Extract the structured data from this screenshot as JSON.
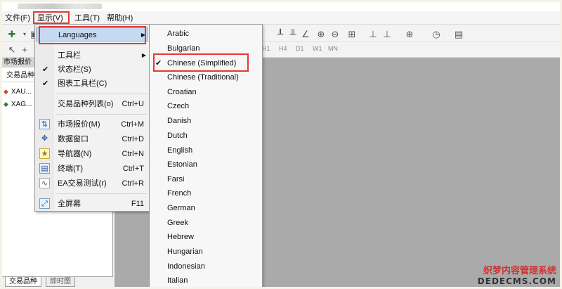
{
  "menubar": {
    "file": "文件(F)",
    "view": "显示(V)",
    "tools": "工具(T)",
    "help": "帮助(H)"
  },
  "toolbar": {
    "timeframes": [
      "H1",
      "H4",
      "D1",
      "W1",
      "MN"
    ]
  },
  "left_panel": {
    "title": "市场报价",
    "header": "交易品种",
    "symbols": [
      {
        "name": "XAU...",
        "direction": "down",
        "color": "#d84315"
      },
      {
        "name": "XAG...",
        "direction": "up",
        "color": "#2e7d32"
      }
    ],
    "tabs": [
      "交易品种",
      "即时图"
    ]
  },
  "view_menu": {
    "languages": "Languages",
    "toolbars": "工具栏",
    "status_bar": "状态栏(S)",
    "chart_toolbar": "图表工具栏(C)",
    "symbols_list": "交易品种列表(o)",
    "symbols_list_sc": "Ctrl+U",
    "market_watch": "市场报价(M)",
    "market_watch_sc": "Ctrl+M",
    "data_window": "数据窗口",
    "data_window_sc": "Ctrl+D",
    "navigator": "导航器(N)",
    "navigator_sc": "Ctrl+N",
    "terminal": "终端(T)",
    "terminal_sc": "Ctrl+T",
    "tester": "EA交易测试(r)",
    "tester_sc": "Ctrl+R",
    "fullscreen": "全屏幕",
    "fullscreen_sc": "F11"
  },
  "languages_submenu": {
    "items": [
      "Arabic",
      "Bulgarian",
      "Chinese (Simplified)",
      "Chinese (Traditional)",
      "Croatian",
      "Czech",
      "Danish",
      "Dutch",
      "English",
      "Estonian",
      "Farsi",
      "French",
      "German",
      "Greek",
      "Hebrew",
      "Hungarian",
      "Indonesian",
      "Italian"
    ],
    "selected": "Chinese (Simplified)"
  },
  "watermark": {
    "line1": "织梦内容管理系统",
    "line2": "DEDECMS.COM"
  },
  "colors": {
    "highlight_box": "#e53935",
    "menu_highlight": "#c5d9f1",
    "chart_bg": "#aaaaaa"
  }
}
